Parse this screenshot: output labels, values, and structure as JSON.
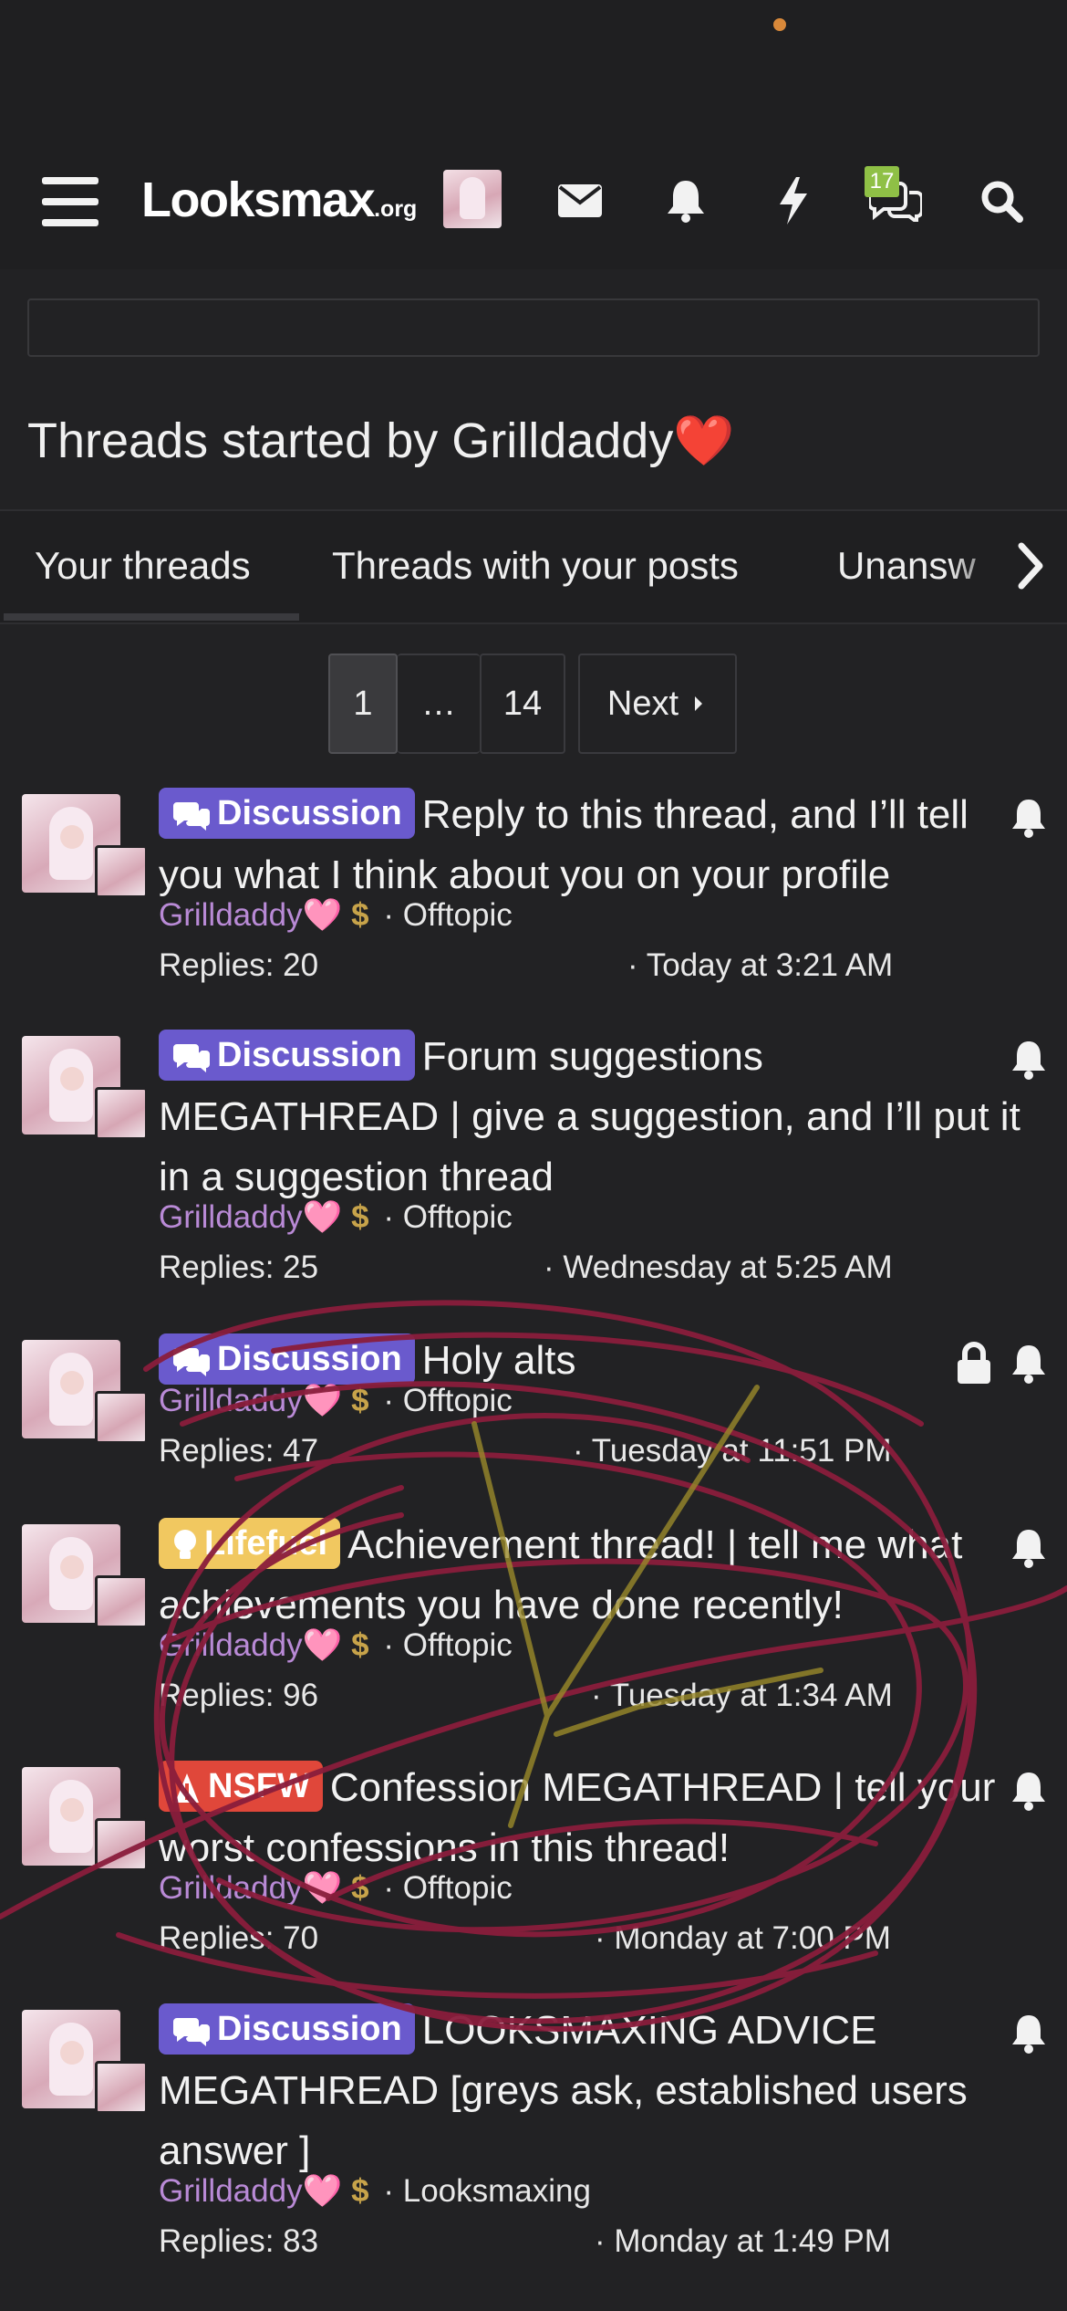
{
  "header": {
    "logo_main": "Looksmax",
    "logo_suffix": ".org",
    "chat_badge": "17",
    "icons": [
      "menu-icon",
      "envelope-icon",
      "bell-icon",
      "bolt-icon",
      "chat-icon",
      "search-icon"
    ]
  },
  "page": {
    "title": "Threads started by Grilldaddy",
    "title_emoji": "❤️"
  },
  "tabs": [
    {
      "label": "Your threads",
      "active": true
    },
    {
      "label": "Threads with your posts",
      "active": false
    },
    {
      "label": "Unansw",
      "active": false
    }
  ],
  "pagination": {
    "current": "1",
    "ellipsis": "…",
    "last": "14",
    "next": "Next"
  },
  "threads": [
    {
      "prefix": "Discussion",
      "prefix_type": "discussion",
      "title": "Reply to this thread, and I’ll tell you what I think about you on your profile",
      "author": "Grilldaddy",
      "author_heart": "🩷",
      "forum": "Offtopic",
      "replies": "Replies: 20",
      "date": "Today at 3:21 AM",
      "locked": false
    },
    {
      "prefix": "Discussion",
      "prefix_type": "discussion",
      "title": "Forum suggestions MEGATHREAD | give a suggestion, and I’ll put it in a suggestion thread",
      "author": "Grilldaddy",
      "author_heart": "🩷",
      "forum": "Offtopic",
      "replies": "Replies: 25",
      "date": "Wednesday at 5:25 AM",
      "locked": false
    },
    {
      "prefix": "Discussion",
      "prefix_type": "discussion",
      "title": "Holy alts",
      "author": "Grilldaddy",
      "author_heart": "🩷",
      "forum": "Offtopic",
      "replies": "Replies: 47",
      "date": "Tuesday at 11:51 PM",
      "locked": true
    },
    {
      "prefix": "Lifefuel",
      "prefix_type": "lifefuel",
      "title": "Achievement thread! | tell me what achievements you have done recently!",
      "author": "Grilldaddy",
      "author_heart": "🩷",
      "forum": "Offtopic",
      "replies": "Replies: 96",
      "date": "Tuesday at 1:34 AM",
      "locked": false
    },
    {
      "prefix": "NSFW",
      "prefix_type": "nsfw",
      "title": "Confession MEGATHREAD | tell your worst confessions in this thread!",
      "author": "Grilldaddy",
      "author_heart": "🩷",
      "forum": "Offtopic",
      "replies": "Replies: 70",
      "date": "Monday at 7:00 PM",
      "locked": false
    },
    {
      "prefix": "Discussion",
      "prefix_type": "discussion",
      "title": "LOOKSMAXING ADVICE MEGATHREAD [greys ask, established users answer ]",
      "author": "Grilldaddy",
      "author_heart": "🩷",
      "forum": "Looksmaxing",
      "replies": "Replies: 83",
      "date": "Monday at 1:49 PM",
      "locked": false
    }
  ],
  "colors": {
    "background": "#222224",
    "discussion_prefix": "#6a5acd",
    "lifefuel_prefix": "#f1c860",
    "nsfw_prefix": "#e0473a",
    "username": "#b98ad6",
    "badge": "#8fc046",
    "scribble": "#8a1d3c"
  }
}
